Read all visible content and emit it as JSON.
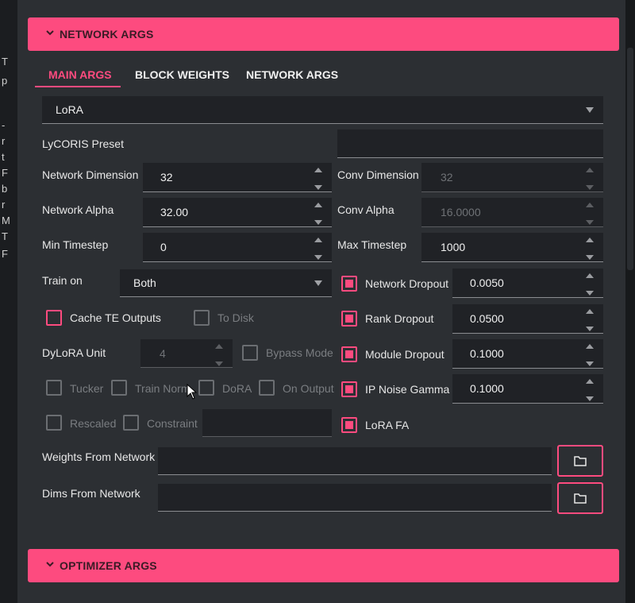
{
  "sections": {
    "network_args_title": "NETWORK ARGS",
    "optimizer_args_title": "OPTIMIZER ARGS"
  },
  "tabs": [
    "MAIN ARGS",
    "BLOCK WEIGHTS",
    "NETWORK ARGS"
  ],
  "left_strip_chars": [
    "T",
    "p",
    "",
    "-",
    "r",
    "t",
    "F",
    "b",
    "r",
    "M",
    "T",
    "F"
  ],
  "algo_select": "LoRA",
  "lycoris_preset": {
    "label": "LyCORIS Preset",
    "value": ""
  },
  "network_dimension": {
    "label": "Network Dimension",
    "value": "32"
  },
  "network_alpha": {
    "label": "Network Alpha",
    "value": "32.00"
  },
  "min_timestep": {
    "label": "Min Timestep",
    "value": "0"
  },
  "conv_dimension": {
    "label": "Conv Dimension",
    "value": "32"
  },
  "conv_alpha": {
    "label": "Conv Alpha",
    "value": "16.0000"
  },
  "max_timestep": {
    "label": "Max Timestep",
    "value": "1000"
  },
  "train_on": {
    "label": "Train on",
    "value": "Both"
  },
  "cache_te_outputs": "Cache TE Outputs",
  "to_disk": "To Disk",
  "dylora_unit": {
    "label": "DyLoRA Unit",
    "value": "4"
  },
  "bypass_mode": "Bypass Mode",
  "tucker": "Tucker",
  "train_norm": "Train Norm",
  "dora": "DoRA",
  "on_output": "On Output",
  "rescaled": "Rescaled",
  "constraint": "Constraint",
  "network_dropout": {
    "label": "Network Dropout",
    "value": "0.0050"
  },
  "rank_dropout": {
    "label": "Rank Dropout",
    "value": "0.0500"
  },
  "module_dropout": {
    "label": "Module Dropout",
    "value": "0.1000"
  },
  "ip_noise_gamma": {
    "label": "IP Noise Gamma",
    "value": "0.1000"
  },
  "lora_fa": "LoRA FA",
  "weights_from_network": {
    "label": "Weights From Network",
    "value": ""
  },
  "dims_from_network": {
    "label": "Dims From Network",
    "value": ""
  },
  "colors": {
    "accent": "#fd4b7f",
    "panel": "#2c2f33",
    "field": "#202226"
  }
}
